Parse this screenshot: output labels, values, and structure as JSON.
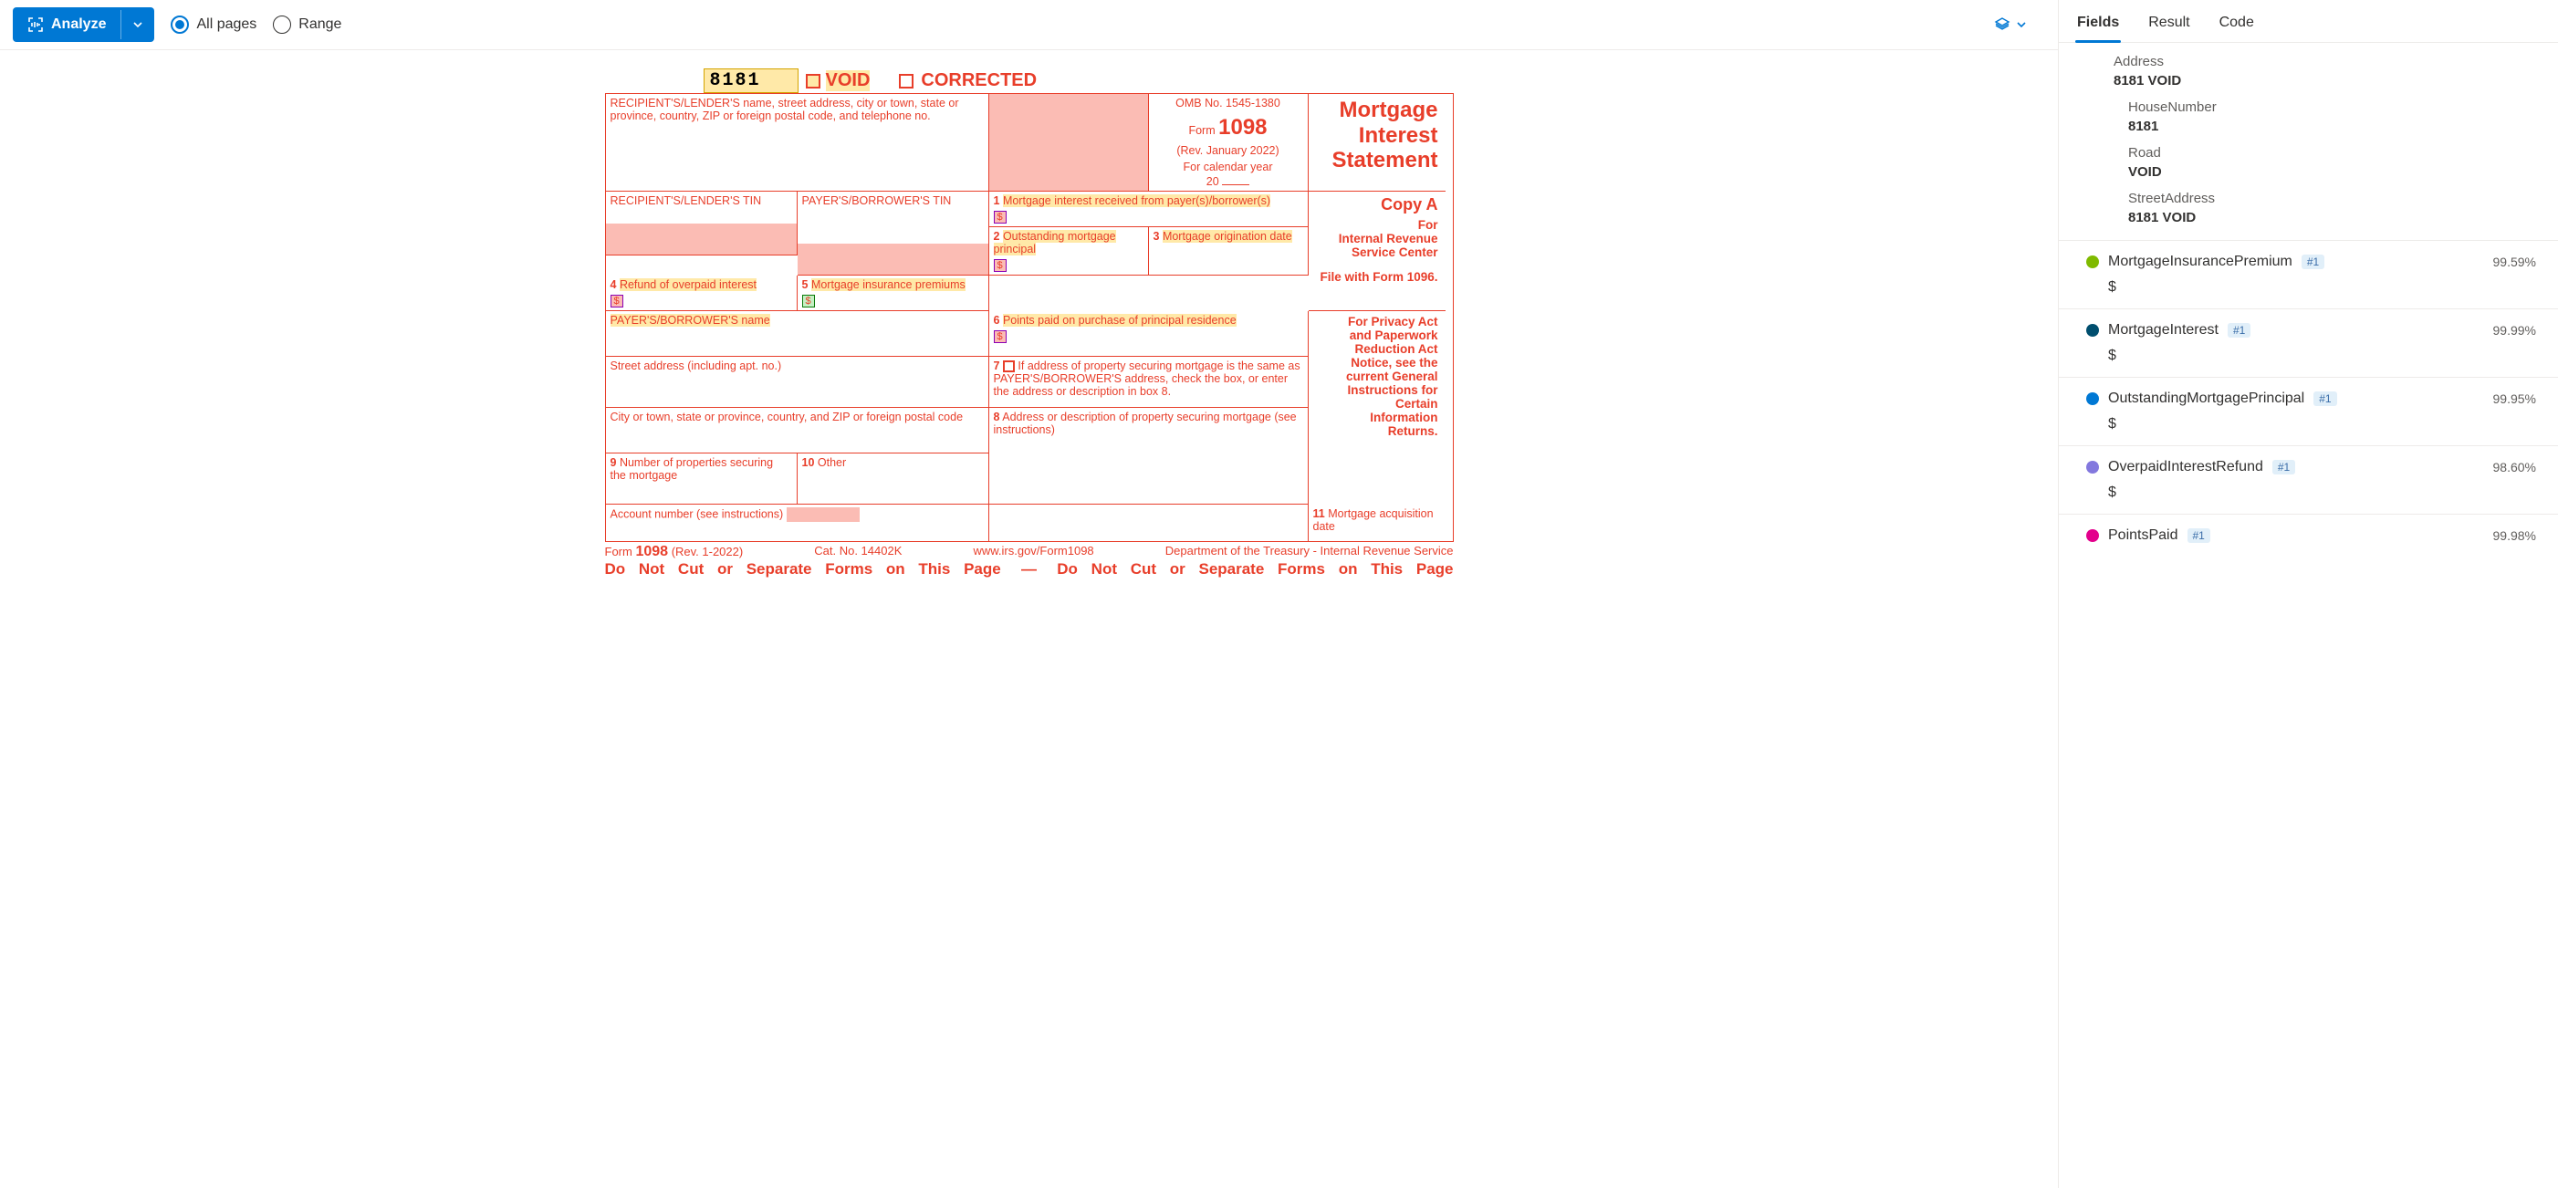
{
  "toolbar": {
    "analyze_label": "Analyze",
    "all_pages": "All pages",
    "range": "Range"
  },
  "form": {
    "code": "8181",
    "void": "VOID",
    "corrected": "CORRECTED",
    "recipient_lender_label": "RECIPIENT'S/LENDER'S name, street address, city or town, state or province, country, ZIP or foreign postal code, and telephone no.",
    "omb": "OMB No. 1545-1380",
    "form_word": "Form",
    "form_no": "1098",
    "rev": "(Rev. January 2022)",
    "cal_year": "For calendar year",
    "year_prefix": "20",
    "title1": "Mortgage",
    "title2": "Interest",
    "title3": "Statement",
    "box1_label": "Mortgage interest received from payer(s)/borrower(s)",
    "box1_no": "1",
    "copy_a": "Copy A",
    "for_line": "For",
    "irs1": "Internal Revenue",
    "irs2": "Service Center",
    "file_with": "File with Form 1096.",
    "privacy1": "For Privacy Act",
    "privacy2": "and Paperwork",
    "privacy3": "Reduction Act",
    "privacy4": "Notice, see the",
    "privacy5": "current General",
    "privacy6": "Instructions for",
    "privacy7": "Certain",
    "privacy8": "Information",
    "privacy9": "Returns.",
    "lender_tin": "RECIPIENT'S/LENDER'S TIN",
    "payer_tin": "PAYER'S/BORROWER'S TIN",
    "box2_no": "2",
    "box2_label": "Outstanding mortgage principal",
    "box3_no": "3",
    "box3_label": "Mortgage origination date",
    "box4_no": "4",
    "box4_label": "Refund of overpaid interest",
    "box5_no": "5",
    "box5_label": "Mortgage insurance premiums",
    "payer_name": "PAYER'S/BORROWER'S name",
    "box6_no": "6",
    "box6_label": "Points paid on purchase of principal residence",
    "street": "Street address (including apt. no.)",
    "box7_no": "7",
    "box7_label": "If address of property securing mortgage is the same as PAYER'S/BORROWER'S address, check the box, or enter the address or description in box 8.",
    "city": "City or town, state or province, country, and ZIP or foreign postal code",
    "box8_no": "8",
    "box8_label": "Address or description of property securing mortgage (see instructions)",
    "box9_no": "9",
    "box9_label": "Number of properties securing the mortgage",
    "box10_no": "10",
    "box10_label": "Other",
    "box11_no": "11",
    "box11_label": "Mortgage acquisition date",
    "acct": "Account number (see instructions)",
    "footer_form": "Form",
    "footer_1098": "1098",
    "footer_rev": "(Rev. 1-2022)",
    "cat": "Cat. No. 14402K",
    "url": "www.irs.gov/Form1098",
    "dept": "Department of the Treasury - Internal Revenue Service",
    "nocut": "Do Not Cut or Separate Forms on This Page",
    "dash": "—"
  },
  "right": {
    "tab_fields": "Fields",
    "tab_result": "Result",
    "tab_code": "Code",
    "address_lbl": "Address",
    "address_val": "8181 VOID",
    "house_lbl": "HouseNumber",
    "house_val": "8181",
    "road_lbl": "Road",
    "road_val": "VOID",
    "street_lbl": "StreetAddress",
    "street_val": "8181 VOID",
    "fields": [
      {
        "color": "#7fba00",
        "name": "MortgageInsurancePremium",
        "badge": "#1",
        "conf": "99.59%",
        "val": "$"
      },
      {
        "color": "#004e6e",
        "name": "MortgageInterest",
        "badge": "#1",
        "conf": "99.99%",
        "val": "$"
      },
      {
        "color": "#0078d4",
        "name": "OutstandingMortgagePrincipal",
        "badge": "#1",
        "conf": "99.95%",
        "val": "$"
      },
      {
        "color": "#8378de",
        "name": "OverpaidInterestRefund",
        "badge": "#1",
        "conf": "98.60%",
        "val": "$"
      },
      {
        "color": "#e3008c",
        "name": "PointsPaid",
        "badge": "#1",
        "conf": "99.98%",
        "val": ""
      }
    ]
  }
}
